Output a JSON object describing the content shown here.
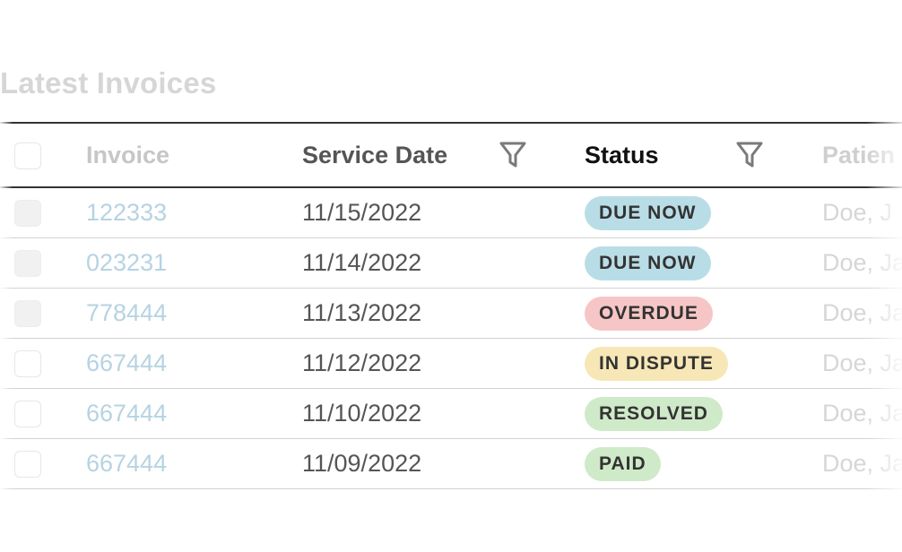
{
  "title": "Latest Invoices",
  "columns": {
    "invoice": "Invoice",
    "service_date": "Service Date",
    "status": "Status",
    "patient": "Patien"
  },
  "icons": {
    "service_date_filter": "filter-icon",
    "status_filter": "filter-icon"
  },
  "status_colors": {
    "DUE NOW": "#b9dde6",
    "OVERDUE": "#f6c6c6",
    "IN DISPUTE": "#f7e7b6",
    "RESOLVED": "#cfeac8",
    "PAID": "#cfeac8"
  },
  "rows": [
    {
      "invoice": "122333",
      "service_date": "11/15/2022",
      "status": "DUE NOW",
      "patient": "Doe, J"
    },
    {
      "invoice": "023231",
      "service_date": "11/14/2022",
      "status": "DUE NOW",
      "patient": "Doe, Ja"
    },
    {
      "invoice": "778444",
      "service_date": "11/13/2022",
      "status": "OVERDUE",
      "patient": "Doe, Ja"
    },
    {
      "invoice": "667444",
      "service_date": "11/12/2022",
      "status": "IN DISPUTE",
      "patient": "Doe, Ja"
    },
    {
      "invoice": "667444",
      "service_date": "11/10/2022",
      "status": "RESOLVED",
      "patient": "Doe, Ja"
    },
    {
      "invoice": "667444",
      "service_date": "11/09/2022",
      "status": "PAID",
      "patient": "Doe, Ja"
    }
  ]
}
